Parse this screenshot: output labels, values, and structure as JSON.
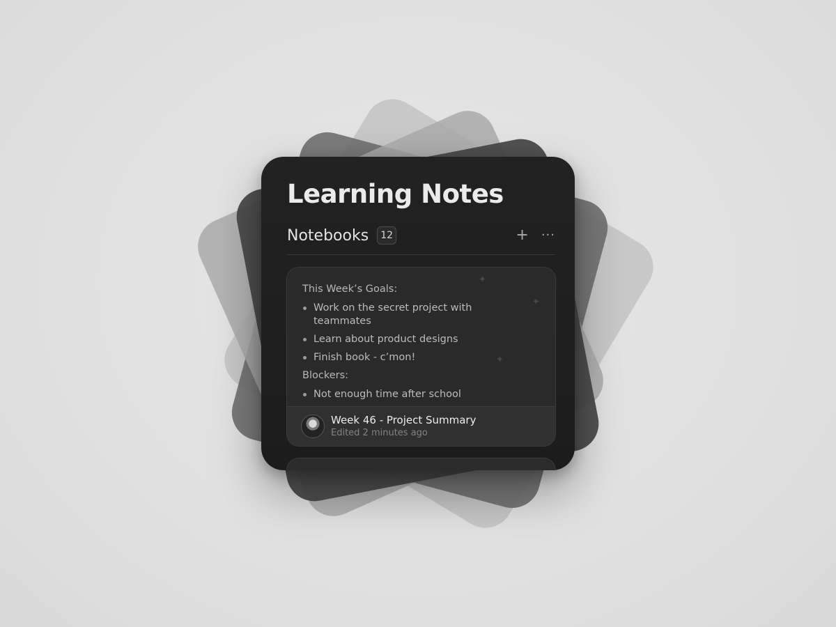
{
  "widget": {
    "title": "Learning Notes",
    "section": {
      "label": "Notebooks",
      "count": "12"
    },
    "actions": {
      "add_icon": "plus-icon",
      "more_icon": "ellipsis-icon"
    },
    "note": {
      "goals_heading": "This Week’s Goals:",
      "goals": [
        "Work on the secret project with teammates",
        "Learn about product designs",
        "Finish book - c’mon!"
      ],
      "blockers_heading": "Blockers:",
      "blockers": [
        "Not enough time after school"
      ],
      "title": "Week 46 - Project Summary",
      "meta": "Edited 2 minutes ago",
      "avatar_icon": "avatar"
    }
  },
  "colors": {
    "background": "#e2e2e2",
    "widget": "#1f1f1f",
    "card": "#2a2a2a",
    "text_primary": "#ebebeb",
    "text_secondary": "#828282"
  }
}
